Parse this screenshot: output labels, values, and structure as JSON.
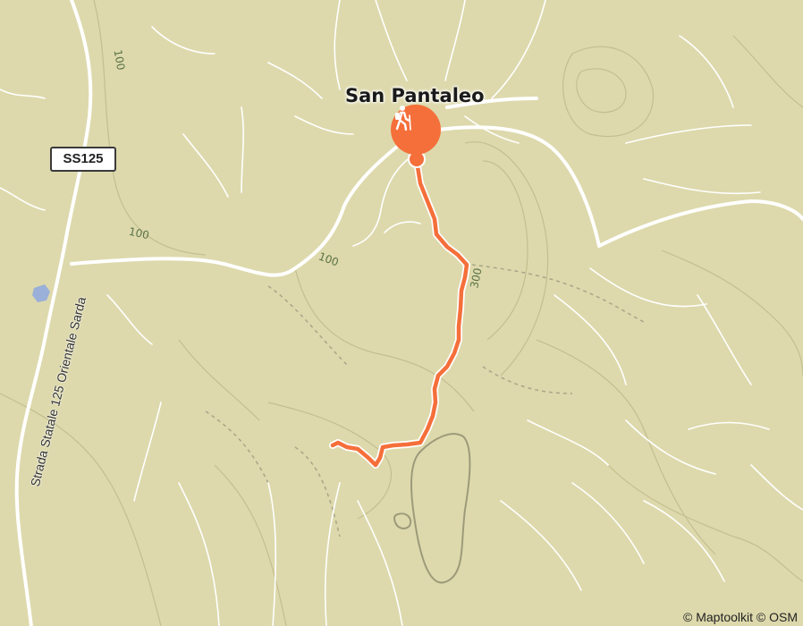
{
  "map": {
    "place_label": "San Pantaleo",
    "road_shield": "SS125",
    "road_name": "Strada Statale 125 Orientale Sarda",
    "contour_labels": [
      "100",
      "100",
      "100",
      "300"
    ],
    "attribution": "© Maptoolkit © OSM",
    "marker_icon": "hiking-icon",
    "route_color": "#f56f3a",
    "land_color": "#ddd9ac",
    "road_color": "#ffffff"
  }
}
